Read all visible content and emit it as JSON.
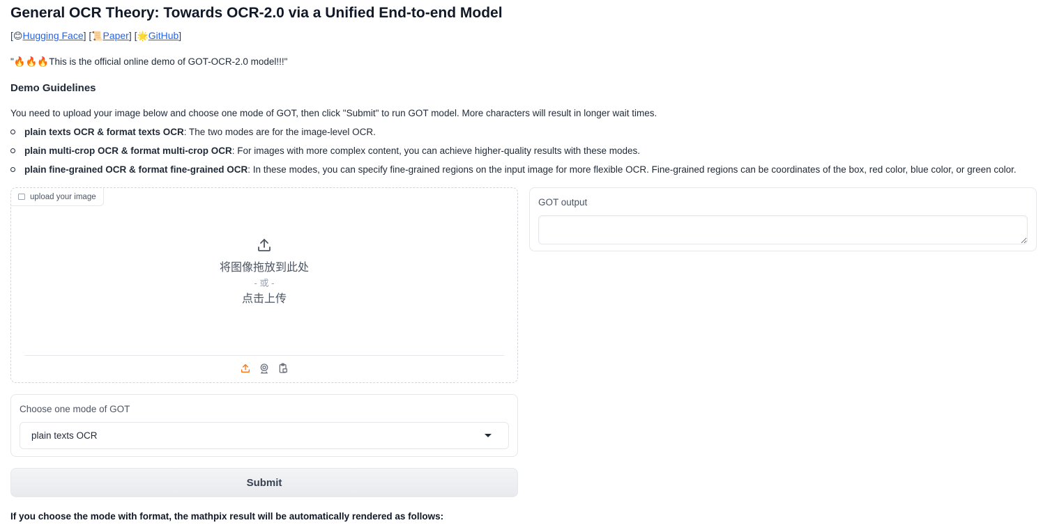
{
  "header": {
    "title": "General OCR Theory: Towards OCR-2.0 via a Unified End-to-end Model",
    "links": [
      {
        "emoji": "😊",
        "label": "Hugging Face"
      },
      {
        "emoji": "📜",
        "label": "Paper"
      },
      {
        "emoji": "🌟",
        "label": "GitHub"
      }
    ],
    "intro": "\"🔥🔥🔥This is the official online demo of GOT-OCR-2.0 model!!!\""
  },
  "guidelines": {
    "heading": "Demo Guidelines",
    "description": "You need to upload your image below and choose one mode of GOT, then click \"Submit\" to run GOT model. More characters will result in longer wait times.",
    "items": [
      {
        "bold": "plain texts OCR & format texts OCR",
        "text": ": The two modes are for the image-level OCR."
      },
      {
        "bold": "plain multi-crop OCR & format multi-crop OCR",
        "text": ": For images with more complex content, you can achieve higher-quality results with these modes."
      },
      {
        "bold": "plain fine-grained OCR & format fine-grained OCR",
        "text": ": In these modes, you can specify fine-grained regions on the input image for more flexible OCR. Fine-grained regions can be coordinates of the box, red color, blue color, or green color."
      }
    ]
  },
  "upload": {
    "label": "upload your image",
    "drop_text": "将图像拖放到此处",
    "or_text": "- 或 -",
    "click_text": "点击上传",
    "accent_color": "#f97316"
  },
  "mode": {
    "label": "Choose one mode of GOT",
    "selected": "plain texts OCR"
  },
  "submit_label": "Submit",
  "output": {
    "label": "GOT output",
    "value": ""
  },
  "footer_note": "If you choose the mode with format, the mathpix result will be automatically rendered as follows:"
}
